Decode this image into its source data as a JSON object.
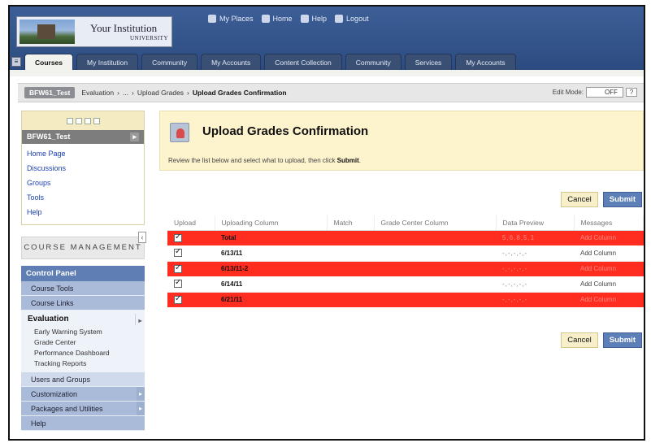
{
  "header": {
    "institution_name": "Your Institution",
    "institution_sub": "UNIVERSITY",
    "top_links": [
      {
        "label": "My Places",
        "icon": "person-icon"
      },
      {
        "label": "Home",
        "icon": "home-icon"
      },
      {
        "label": "Help",
        "icon": "help-icon"
      },
      {
        "label": "Logout",
        "icon": "logout-icon"
      }
    ],
    "tabs": [
      "Courses",
      "My Institution",
      "Community",
      "My Accounts",
      "Content Collection",
      "Community",
      "Services",
      "My Accounts"
    ],
    "active_tab": "Courses"
  },
  "breadcrumb": {
    "course": "BFW61_Test",
    "items": [
      "Evaluation",
      "...",
      "Upload Grades",
      "Upload Grades Confirmation"
    ],
    "edit_mode_label": "Edit Mode:",
    "edit_mode_value": "OFF",
    "help_label": "?"
  },
  "sidebar": {
    "course_title": "BFW61_Test",
    "course_links": [
      "Home Page",
      "Discussions",
      "Groups",
      "Tools",
      "Help"
    ],
    "course_management_label": "COURSE MANAGEMENT",
    "control_panel_label": "Control Panel",
    "cp_items": [
      "Course Tools",
      "Course Links"
    ],
    "evaluation_label": "Evaluation",
    "evaluation_items": [
      "Early Warning System",
      "Grade Center",
      "Performance Dashboard",
      "Tracking Reports"
    ],
    "cp_items_after": [
      "Users and Groups",
      "Customization",
      "Packages and Utilities",
      "Help"
    ]
  },
  "page": {
    "title": "Upload Grades Confirmation",
    "instructions_prefix": "Review the list below and select what to upload, then click ",
    "instructions_bold": "Submit",
    "instructions_suffix": ".",
    "cancel_label": "Cancel",
    "submit_label": "Submit"
  },
  "table": {
    "headers": [
      "Upload",
      "Uploading Column",
      "Match",
      "Grade Center Column",
      "Data Preview",
      "Messages"
    ],
    "rows": [
      {
        "column": "Total",
        "match": "",
        "gc_column": "",
        "preview": "5,6,8,5,1",
        "message": "Add Column",
        "error": true
      },
      {
        "column": "6/13/11",
        "match": "",
        "gc_column": "",
        "preview": "-,-,-,-,-",
        "message": "Add Column",
        "error": false
      },
      {
        "column": "6/13/11-2",
        "match": "",
        "gc_column": "",
        "preview": "-,-,-,-,-",
        "message": "Add Column",
        "error": true
      },
      {
        "column": "6/14/11",
        "match": "",
        "gc_column": "",
        "preview": "-,-,-,-,-",
        "message": "Add Column",
        "error": false
      },
      {
        "column": "6/21/11",
        "match": "",
        "gc_column": "",
        "preview": "-,-,-,-,-",
        "message": "Add Column",
        "error": true
      }
    ]
  },
  "colors": {
    "header_blue": "#2f4f86",
    "error_row": "#ff2d1f",
    "submit_blue": "#5c7fb7",
    "title_bg": "#fdf3cd"
  }
}
